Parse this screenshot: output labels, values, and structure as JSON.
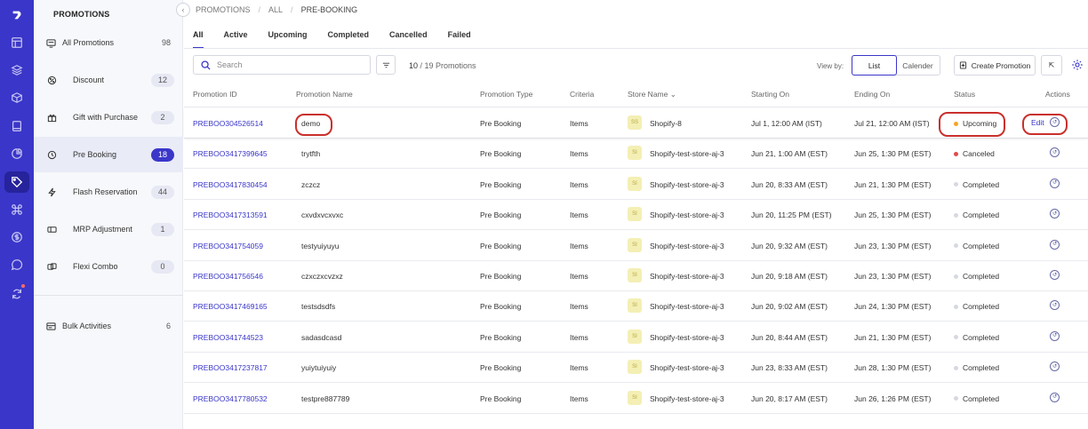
{
  "sidebar": {
    "title": "PROMOTIONS",
    "items": [
      {
        "label": "All Promotions",
        "count": "98"
      },
      {
        "label": "Discount",
        "count": "12"
      },
      {
        "label": "Gift with Purchase",
        "count": "2"
      },
      {
        "label": "Pre Booking",
        "count": "18"
      },
      {
        "label": "Flash Reservation",
        "count": "44"
      },
      {
        "label": "MRP Adjustment",
        "count": "1"
      },
      {
        "label": "Flexi Combo",
        "count": "0"
      }
    ],
    "bulk": {
      "label": "Bulk Activities",
      "count": "6"
    }
  },
  "breadcrumb": [
    "PROMOTIONS",
    "ALL",
    "PRE-BOOKING"
  ],
  "tabs": [
    "All",
    "Active",
    "Upcoming",
    "Completed",
    "Cancelled",
    "Failed"
  ],
  "toolbar": {
    "search_placeholder": "Search",
    "count_shown": "10",
    "count_total": "/ 19 Promotions",
    "view_by_label": "View by:",
    "view_list": "List",
    "view_calendar": "Calender",
    "create_label": "Create Promotion"
  },
  "table": {
    "headers": [
      "Promotion ID",
      "Promotion Name",
      "Promotion Type",
      "Criteria",
      "Store Name",
      "Starting On",
      "Ending On",
      "Status",
      "Actions"
    ],
    "rows": [
      {
        "id": "PREBOO304526514",
        "name": "demo",
        "type": "Pre Booking",
        "criteria": "Items",
        "store_initials": "SS",
        "store": "Shopify-8",
        "start": "Jul 1, 12:00 AM (IST)",
        "end": "Jul 21, 12:00 AM (IST)",
        "status": "Upcoming",
        "edit": "Edit"
      },
      {
        "id": "PREBOO3417399645",
        "name": "trytfth",
        "type": "Pre Booking",
        "criteria": "Items",
        "store_initials": "SI",
        "store": "Shopify-test-store-aj-3",
        "start": "Jun 21, 1:00 AM (EST)",
        "end": "Jun 25, 1:30 PM (EST)",
        "status": "Canceled"
      },
      {
        "id": "PREBOO3417830454",
        "name": "zczcz",
        "type": "Pre Booking",
        "criteria": "Items",
        "store_initials": "SI",
        "store": "Shopify-test-store-aj-3",
        "start": "Jun 20, 8:33 AM (EST)",
        "end": "Jun 21, 1:30 PM (EST)",
        "status": "Completed"
      },
      {
        "id": "PREBOO3417313591",
        "name": "cxvdxvcxvxc",
        "type": "Pre Booking",
        "criteria": "Items",
        "store_initials": "SI",
        "store": "Shopify-test-store-aj-3",
        "start": "Jun 20, 11:25 PM (EST)",
        "end": "Jun 25, 1:30 PM (EST)",
        "status": "Completed"
      },
      {
        "id": "PREBOO341754059",
        "name": "testyuiyuyu",
        "type": "Pre Booking",
        "criteria": "Items",
        "store_initials": "SI",
        "store": "Shopify-test-store-aj-3",
        "start": "Jun 20, 9:32 AM (EST)",
        "end": "Jun 23, 1:30 PM (EST)",
        "status": "Completed"
      },
      {
        "id": "PREBOO341756546",
        "name": "czxczxcvzxz",
        "type": "Pre Booking",
        "criteria": "Items",
        "store_initials": "SI",
        "store": "Shopify-test-store-aj-3",
        "start": "Jun 20, 9:18 AM (EST)",
        "end": "Jun 23, 1:30 PM (EST)",
        "status": "Completed"
      },
      {
        "id": "PREBOO3417469165",
        "name": "testsdsdfs",
        "type": "Pre Booking",
        "criteria": "Items",
        "store_initials": "SI",
        "store": "Shopify-test-store-aj-3",
        "start": "Jun 20, 9:02 AM (EST)",
        "end": "Jun 24, 1:30 PM (EST)",
        "status": "Completed"
      },
      {
        "id": "PREBOO341744523",
        "name": "sadasdcasd",
        "type": "Pre Booking",
        "criteria": "Items",
        "store_initials": "SI",
        "store": "Shopify-test-store-aj-3",
        "start": "Jun 20, 8:44 AM (EST)",
        "end": "Jun 21, 1:30 PM (EST)",
        "status": "Completed"
      },
      {
        "id": "PREBOO3417237817",
        "name": "yuiytuiyuiy",
        "type": "Pre Booking",
        "criteria": "Items",
        "store_initials": "SI",
        "store": "Shopify-test-store-aj-3",
        "start": "Jun 23, 8:33 AM (EST)",
        "end": "Jun 28, 1:30 PM (EST)",
        "status": "Completed"
      },
      {
        "id": "PREBOO3417780532",
        "name": "testpre887789",
        "type": "Pre Booking",
        "criteria": "Items",
        "store_initials": "SI",
        "store": "Shopify-test-store-aj-3",
        "start": "Jun 20, 8:17 AM (EST)",
        "end": "Jun 26, 1:26 PM (EST)",
        "status": "Completed"
      }
    ]
  },
  "colors": {
    "brand": "#3a36c9",
    "upcoming": "#f5a623",
    "canceled": "#e5484d",
    "completed": "#d7d9e0",
    "annotation": "#c9302c"
  },
  "icons": {
    "action": "history-icon"
  }
}
